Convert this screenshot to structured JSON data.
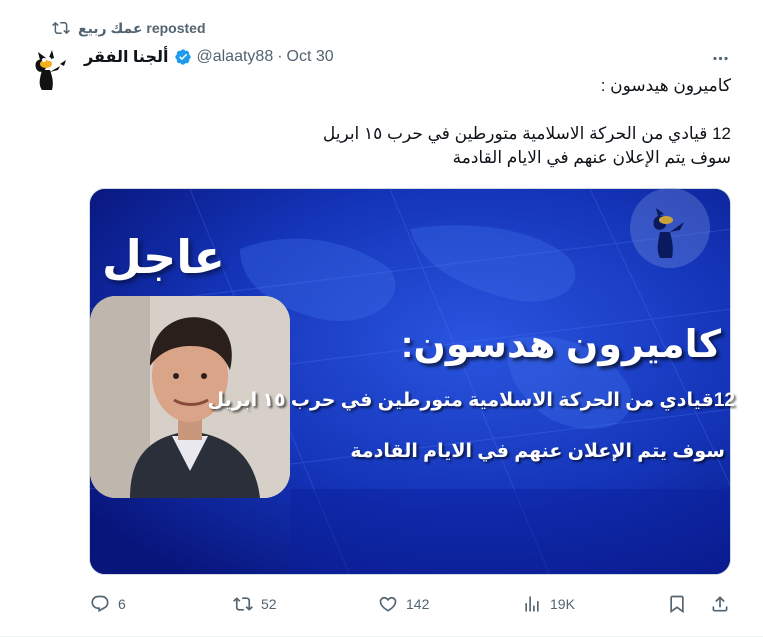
{
  "repost": {
    "label": "عمك ربيع reposted",
    "icon": "repost-icon"
  },
  "author": {
    "display_name": "ألجنا الفقر",
    "handle": "@alaaty88",
    "separator": "·",
    "date": "Oct 30",
    "verified": true
  },
  "tweet": {
    "line1": "كاميرون هيدسون :",
    "line2": "12 قيادي من الحركة الاسلامية متورطين في حرب ١٥ ابريل",
    "line3": "سوف يتم الإعلان عنهم في الايام القادمة"
  },
  "media": {
    "breaking_label": "عاجل",
    "name": "كاميرون هدسون:",
    "line1": "12قيادي من الحركة الاسلامية متورطين في حرب ١٥ ابريل",
    "line2": "سوف يتم الإعلان عنهم في الايام القادمة",
    "background_color": "#0a1e9a"
  },
  "actions": {
    "replies": "6",
    "reposts": "52",
    "likes": "142",
    "views": "19K"
  },
  "colors": {
    "text_primary": "#0f1419",
    "text_secondary": "#536471",
    "verified": "#1d9bf0"
  }
}
